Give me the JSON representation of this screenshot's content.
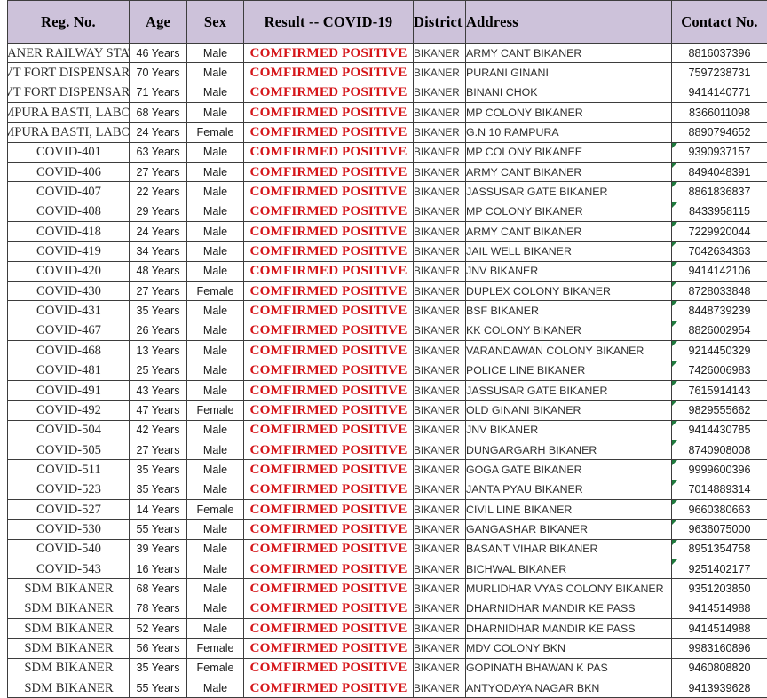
{
  "table": {
    "columns": [
      {
        "key": "reg",
        "label": "Reg. No."
      },
      {
        "key": "age",
        "label": "Age"
      },
      {
        "key": "sex",
        "label": "Sex"
      },
      {
        "key": "res",
        "label": "Result  -- COVID-19"
      },
      {
        "key": "dist",
        "label": "District"
      },
      {
        "key": "addr",
        "label": "Address"
      },
      {
        "key": "cont",
        "label": "Contact No."
      }
    ],
    "header_bg": "#cdc2da",
    "result_color": "#d5161a",
    "error_marker_color": "#1f7a3d",
    "error_marker_name": "number-stored-as-text-indicator",
    "rows": [
      {
        "reg": "BIKANER RAILWAY STATION",
        "overflow": true,
        "age": "46 Years",
        "sex": "Male",
        "res": "COMFIRMED POSITIVE",
        "dist": "BIKANER",
        "addr": "ARMY CANT BIKANER",
        "cont": "8816037396",
        "err": false
      },
      {
        "reg": "GOVT FORT DISPENSARY",
        "overflow": true,
        "age": "70 Years",
        "sex": "Male",
        "res": "COMFIRMED POSITIVE",
        "dist": "BIKANER",
        "addr": "PURANI GINANI",
        "cont": "7597238731",
        "err": false
      },
      {
        "reg": "GOVT FORT DISPENSARY",
        "overflow": true,
        "age": "71 Years",
        "sex": "Male",
        "res": "COMFIRMED POSITIVE",
        "dist": "BIKANER",
        "addr": "BINANI CHOK",
        "cont": "9414140771",
        "err": false
      },
      {
        "reg": "RAMPURA BASTI, LABOUR",
        "overflow": true,
        "age": "68 Years",
        "sex": "Male",
        "res": "COMFIRMED POSITIVE",
        "dist": "BIKANER",
        "addr": "MP COLONY BIKANER",
        "cont": "8366011098",
        "err": false
      },
      {
        "reg": "RAMPURA BASTI, LABOUR",
        "overflow": true,
        "age": "24 Years",
        "sex": "Female",
        "res": "COMFIRMED POSITIVE",
        "dist": "BIKANER",
        "addr": "G.N 10 RAMPURA",
        "cont": "8890794652",
        "err": false
      },
      {
        "reg": "COVID-401",
        "overflow": false,
        "age": "63 Years",
        "sex": "Male",
        "res": "COMFIRMED POSITIVE",
        "dist": "BIKANER",
        "addr": "MP COLONY BIKANEE",
        "cont": "9390937157",
        "err": true
      },
      {
        "reg": "COVID-406",
        "overflow": false,
        "age": "27 Years",
        "sex": "Male",
        "res": "COMFIRMED POSITIVE",
        "dist": "BIKANER",
        "addr": "ARMY CANT BIKANER",
        "cont": "8494048391",
        "err": true
      },
      {
        "reg": "COVID-407",
        "overflow": false,
        "age": "22 Years",
        "sex": "Male",
        "res": "COMFIRMED POSITIVE",
        "dist": "BIKANER",
        "addr": "JASSUSAR GATE BIKANER",
        "cont": "8861836837",
        "err": true
      },
      {
        "reg": "COVID-408",
        "overflow": false,
        "age": "29 Years",
        "sex": "Male",
        "res": "COMFIRMED POSITIVE",
        "dist": "BIKANER",
        "addr": "MP COLONY BIKANER",
        "cont": "8433958115",
        "err": true
      },
      {
        "reg": "COVID-418",
        "overflow": false,
        "age": "24 Years",
        "sex": "Male",
        "res": "COMFIRMED POSITIVE",
        "dist": "BIKANER",
        "addr": "ARMY CANT BIKANER",
        "cont": "7229920044",
        "err": true
      },
      {
        "reg": "COVID-419",
        "overflow": false,
        "age": "34 Years",
        "sex": "Male",
        "res": "COMFIRMED POSITIVE",
        "dist": "BIKANER",
        "addr": "JAIL WELL BIKANER",
        "cont": "7042634363",
        "err": true
      },
      {
        "reg": "COVID-420",
        "overflow": false,
        "age": "48 Years",
        "sex": "Male",
        "res": "COMFIRMED POSITIVE",
        "dist": "BIKANER",
        "addr": "JNV BIKANER",
        "cont": "9414142106",
        "err": true
      },
      {
        "reg": "COVID-430",
        "overflow": false,
        "age": "27 Years",
        "sex": "Female",
        "res": "COMFIRMED POSITIVE",
        "dist": "BIKANER",
        "addr": "DUPLEX COLONY BIKANER",
        "cont": "8728033848",
        "err": true
      },
      {
        "reg": "COVID-431",
        "overflow": false,
        "age": "35 Years",
        "sex": "Male",
        "res": "COMFIRMED POSITIVE",
        "dist": "BIKANER",
        "addr": "BSF BIKANER",
        "cont": "8448739239",
        "err": true
      },
      {
        "reg": "COVID-467",
        "overflow": false,
        "age": "26 Years",
        "sex": "Male",
        "res": "COMFIRMED POSITIVE",
        "dist": "BIKANER",
        "addr": "KK COLONY BIKANER",
        "cont": "8826002954",
        "err": true
      },
      {
        "reg": "COVID-468",
        "overflow": false,
        "age": "13 Years",
        "sex": "Male",
        "res": "COMFIRMED POSITIVE",
        "dist": "BIKANER",
        "addr": "VARANDAWAN COLONY BIKANER",
        "cont": "9214450329",
        "err": true
      },
      {
        "reg": "COVID-481",
        "overflow": false,
        "age": "25 Years",
        "sex": "Male",
        "res": "COMFIRMED POSITIVE",
        "dist": "BIKANER",
        "addr": "POLICE LINE BIKANER",
        "cont": "7426006983",
        "err": true
      },
      {
        "reg": "COVID-491",
        "overflow": false,
        "age": "43 Years",
        "sex": "Male",
        "res": "COMFIRMED POSITIVE",
        "dist": "BIKANER",
        "addr": "JASSUSAR GATE BIKANER",
        "cont": "7615914143",
        "err": true
      },
      {
        "reg": "COVID-492",
        "overflow": false,
        "age": "47 Years",
        "sex": "Female",
        "res": "COMFIRMED POSITIVE",
        "dist": "BIKANER",
        "addr": "OLD GINANI BIKANER",
        "cont": "9829555662",
        "err": true
      },
      {
        "reg": "COVID-504",
        "overflow": false,
        "age": "42 Years",
        "sex": "Male",
        "res": "COMFIRMED POSITIVE",
        "dist": "BIKANER",
        "addr": "JNV BIKANER",
        "cont": "9414430785",
        "err": true
      },
      {
        "reg": "COVID-505",
        "overflow": false,
        "age": "27 Years",
        "sex": "Male",
        "res": "COMFIRMED POSITIVE",
        "dist": "BIKANER",
        "addr": "DUNGARGARH BIKANER",
        "cont": "8740908008",
        "err": true
      },
      {
        "reg": "COVID-511",
        "overflow": false,
        "age": "35 Years",
        "sex": "Male",
        "res": "COMFIRMED POSITIVE",
        "dist": "BIKANER",
        "addr": "GOGA GATE BIKANER",
        "cont": "9999600396",
        "err": true
      },
      {
        "reg": "COVID-523",
        "overflow": false,
        "age": "35 Years",
        "sex": "Male",
        "res": "COMFIRMED POSITIVE",
        "dist": "BIKANER",
        "addr": "JANTA PYAU BIKANER",
        "cont": "7014889314",
        "err": true
      },
      {
        "reg": "COVID-527",
        "overflow": false,
        "age": "14 Years",
        "sex": "Female",
        "res": "COMFIRMED POSITIVE",
        "dist": "BIKANER",
        "addr": "CIVIL LINE BIKANER",
        "cont": "9660380663",
        "err": true
      },
      {
        "reg": "COVID-530",
        "overflow": false,
        "age": "55 Years",
        "sex": "Male",
        "res": "COMFIRMED POSITIVE",
        "dist": "BIKANER",
        "addr": "GANGASHAR BIKANER",
        "cont": "9636075000",
        "err": true
      },
      {
        "reg": "COVID-540",
        "overflow": false,
        "age": "39 Years",
        "sex": "Male",
        "res": "COMFIRMED POSITIVE",
        "dist": "BIKANER",
        "addr": "BASANT VIHAR BIKANER",
        "cont": "8951354758",
        "err": true
      },
      {
        "reg": "COVID-543",
        "overflow": false,
        "age": "16 Years",
        "sex": "Male",
        "res": "COMFIRMED POSITIVE",
        "dist": "BIKANER",
        "addr": "BICHWAL BIKANER",
        "cont": "9251402177",
        "err": true
      },
      {
        "reg": "SDM BIKANER",
        "overflow": false,
        "age": "68 Years",
        "sex": "Male",
        "res": "COMFIRMED POSITIVE",
        "dist": "BIKANER",
        "addr": "MURLIDHAR VYAS COLONY BIKANER",
        "cont": "9351203850",
        "err": false
      },
      {
        "reg": "SDM BIKANER",
        "overflow": false,
        "age": "78 Years",
        "sex": "Male",
        "res": "COMFIRMED POSITIVE",
        "dist": "BIKANER",
        "addr": "DHARNIDHAR MANDIR KE PASS",
        "cont": "9414514988",
        "err": false
      },
      {
        "reg": "SDM BIKANER",
        "overflow": false,
        "age": "52 Years",
        "sex": "Male",
        "res": "COMFIRMED POSITIVE",
        "dist": "BIKANER",
        "addr": "DHARNIDHAR MANDIR KE PASS",
        "cont": "9414514988",
        "err": false
      },
      {
        "reg": "SDM BIKANER",
        "overflow": false,
        "age": "56 Years",
        "sex": "Female",
        "res": "COMFIRMED POSITIVE",
        "dist": "BIKANER",
        "addr": "MDV COLONY BKN",
        "cont": "9983160896",
        "err": false
      },
      {
        "reg": "SDM BIKANER",
        "overflow": false,
        "age": "35 Years",
        "sex": "Female",
        "res": "COMFIRMED POSITIVE",
        "dist": "BIKANER",
        "addr": "GOPINATH BHAWAN K PAS",
        "cont": "9460808820",
        "err": false
      },
      {
        "reg": "SDM BIKANER",
        "overflow": false,
        "age": "55 Years",
        "sex": "Male",
        "res": "COMFIRMED POSITIVE",
        "dist": "BIKANER",
        "addr": "ANTYODAYA NAGAR BKN",
        "cont": "9413939628",
        "err": false
      }
    ]
  }
}
